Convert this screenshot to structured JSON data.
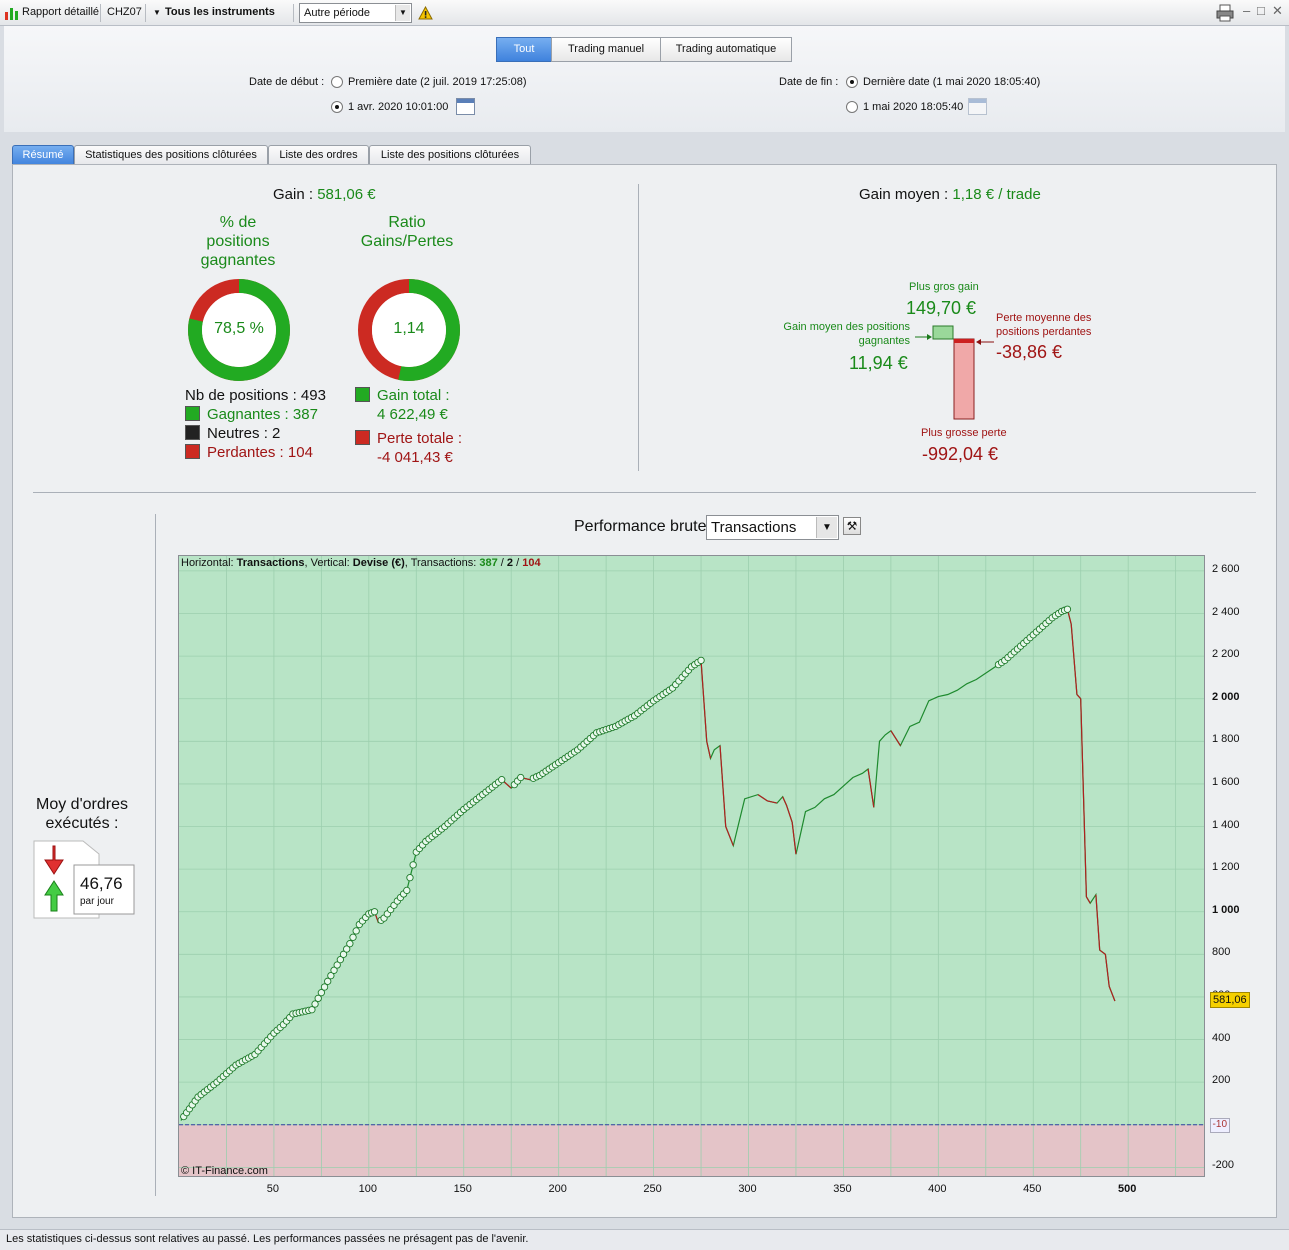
{
  "toolbar": {
    "report_label": "Rapport détaillé",
    "symbol": "CHZ07",
    "instruments_label": "Tous les instruments",
    "period_value": "Autre période",
    "window_buttons": [
      "–",
      "□",
      "✕"
    ]
  },
  "filter": {
    "segments": [
      "Tout",
      "Trading manuel",
      "Trading automatique"
    ],
    "start_label": "Date de début :",
    "start_option1": "Première date (2 juil. 2019 17:25:08)",
    "start_option2": "1 avr. 2020 10:01:00",
    "end_label": "Date de fin :",
    "end_option1": "Dernière date (1 mai 2020 18:05:40)",
    "end_option2": "1 mai 2020 18:05:40"
  },
  "tabs": [
    "Résumé",
    "Statistiques des positions clôturées",
    "Liste des ordres",
    "Liste des positions clôturées"
  ],
  "summary": {
    "gain_label": "Gain :",
    "gain_value": "581,06 €",
    "win_pct_title_1": "% de",
    "win_pct_title_2": "positions",
    "win_pct_title_3": "gagnantes",
    "win_pct_value": "78,5 %",
    "win_fraction": 0.785,
    "ratio_title_1": "Ratio",
    "ratio_title_2": "Gains/Pertes",
    "ratio_value": "1,14",
    "ratio_fraction": 0.533,
    "nb_positions": "Nb de positions : 493",
    "gagnantes": "Gagnantes : 387",
    "neutres": "Neutres : 2",
    "perdantes": "Perdantes : 104",
    "gain_total_label": "Gain total :",
    "gain_total_value": "4 622,49 €",
    "perte_totale_label": "Perte totale :",
    "perte_totale_value": "-4 041,43 €"
  },
  "avg": {
    "gain_moyen_label": "Gain moyen :",
    "gain_moyen_value": "1,18 € / trade",
    "plus_gros_gain_label": "Plus gros gain",
    "plus_gros_gain_value": "149,70 €",
    "gain_moyen_gagnantes_label_1": "Gain moyen des positions",
    "gain_moyen_gagnantes_label_2": "gagnantes",
    "gain_moyen_gagnantes_value": "11,94 €",
    "perte_moyenne_label_1": "Perte moyenne des",
    "perte_moyenne_label_2": "positions perdantes",
    "perte_moyenne_value": "-38,86 €",
    "plus_grosse_perte_label": "Plus grosse perte",
    "plus_grosse_perte_value": "-992,04 €"
  },
  "orders": {
    "title_1": "Moy d'ordres",
    "title_2": "exécutés :",
    "value": "46,76",
    "unit": "par jour"
  },
  "chart_header": {
    "title": "Performance brute",
    "select_value": "Transactions"
  },
  "chart_info": {
    "h_label": "Horizontal: ",
    "h_value": "Transactions",
    "v_label": ", Vertical: ",
    "v_value": "Devise (€)",
    "t_label": ", Transactions: ",
    "t_win": "387",
    "sep1": " / ",
    "t_neutral": "2",
    "sep2": " / ",
    "t_loss": "104",
    "copyright": "© IT-Finance.com",
    "last_value_label": "581,06",
    "zero_label": "-10"
  },
  "chart_data": {
    "type": "line",
    "title": "Performance brute",
    "xlabel": "Transactions",
    "ylabel": "Devise (€)",
    "xlim": [
      0,
      541
    ],
    "ylim": [
      -250,
      2670
    ],
    "x_ticks": [
      50,
      100,
      150,
      200,
      250,
      300,
      350,
      400,
      450,
      500
    ],
    "y_ticks": [
      2600,
      2400,
      2200,
      2000,
      1800,
      1600,
      1400,
      1200,
      1000,
      800,
      600,
      400,
      200,
      -200
    ],
    "y_ticks_labels": [
      "2 600",
      "2 400",
      "2 200",
      "2 000",
      "1 800",
      "1 600",
      "1 400",
      "1 200",
      "1 000",
      "800",
      "600",
      "400",
      "200",
      "-200"
    ],
    "grid": true,
    "series": [
      {
        "x": [
          1,
          10,
          20,
          30,
          40,
          50,
          55,
          60,
          70,
          80,
          90,
          95,
          100,
          103,
          105,
          108,
          115,
          120,
          125,
          130,
          140,
          150,
          160,
          170,
          175,
          180,
          185,
          190,
          200,
          210,
          220,
          230,
          240,
          250,
          260,
          270,
          275,
          278,
          280,
          282,
          285,
          288,
          292,
          298,
          305,
          310,
          315,
          318,
          320,
          323,
          325,
          330,
          335,
          340,
          345,
          350,
          355,
          360,
          363,
          366,
          369,
          372,
          375,
          380,
          385,
          390,
          395,
          400,
          405,
          410,
          415,
          420,
          430,
          435,
          440,
          450,
          460,
          465,
          468,
          470,
          473,
          475,
          478,
          480,
          483,
          485,
          488,
          490,
          493
        ],
        "y": [
          20,
          130,
          200,
          280,
          330,
          430,
          470,
          520,
          540,
          700,
          850,
          940,
          990,
          1000,
          950,
          970,
          1050,
          1100,
          1280,
          1330,
          1400,
          1480,
          1550,
          1620,
          1580,
          1630,
          1620,
          1640,
          1700,
          1760,
          1840,
          1870,
          1920,
          1990,
          2050,
          2150,
          2180,
          1800,
          1720,
          1760,
          1780,
          1400,
          1310,
          1530,
          1550,
          1520,
          1510,
          1540,
          1500,
          1420,
          1270,
          1470,
          1490,
          1530,
          1550,
          1590,
          1630,
          1650,
          1670,
          1490,
          1800,
          1830,
          1850,
          1780,
          1870,
          1890,
          1990,
          2010,
          2020,
          2040,
          2070,
          2090,
          2150,
          2180,
          2220,
          2300,
          2380,
          2410,
          2420,
          2350,
          2020,
          2000,
          1070,
          1040,
          1080,
          820,
          800,
          650,
          581.06
        ]
      }
    ]
  },
  "status": {
    "text": "Les statistiques ci-dessus sont relatives au passé. Les performances passées ne présagent pas de l'avenir."
  }
}
